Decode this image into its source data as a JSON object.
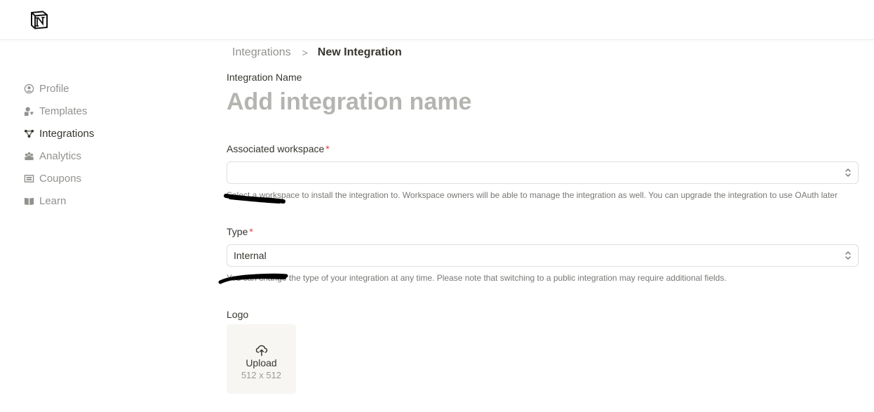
{
  "header": {
    "logo_icon": "notion-logo-icon"
  },
  "sidebar": {
    "items": [
      {
        "label": "Profile",
        "icon": "user-circle-icon",
        "active": false
      },
      {
        "label": "Templates",
        "icon": "shapes-icon",
        "active": false
      },
      {
        "label": "Integrations",
        "icon": "integration-nodes-icon",
        "active": true
      },
      {
        "label": "Analytics",
        "icon": "people-chart-icon",
        "active": false
      },
      {
        "label": "Coupons",
        "icon": "ticket-icon",
        "active": false
      },
      {
        "label": "Learn",
        "icon": "book-icon",
        "active": false
      }
    ]
  },
  "breadcrumb": {
    "parent": "Integrations",
    "separator": ">",
    "current": "New Integration"
  },
  "form": {
    "name_label": "Integration Name",
    "name_placeholder": "Add integration name",
    "name_value": "",
    "workspace_label": "Associated workspace",
    "workspace_required": "*",
    "workspace_value": "",
    "workspace_help": "Select a workspace to install the integration to. Workspace owners will be able to manage the integration as well. You can upgrade the integration to use OAuth later",
    "type_label": "Type",
    "type_required": "*",
    "type_value": "Internal",
    "type_help": "You can change the type of your integration at any time. Please note that switching to a public integration may require additional fields.",
    "logo_label": "Logo",
    "upload_label": "Upload",
    "upload_size": "512 x 512"
  },
  "colors": {
    "text": "#37352f",
    "muted": "#91918e",
    "required": "#e03e3e",
    "upload_bg": "#f7f6f3"
  }
}
